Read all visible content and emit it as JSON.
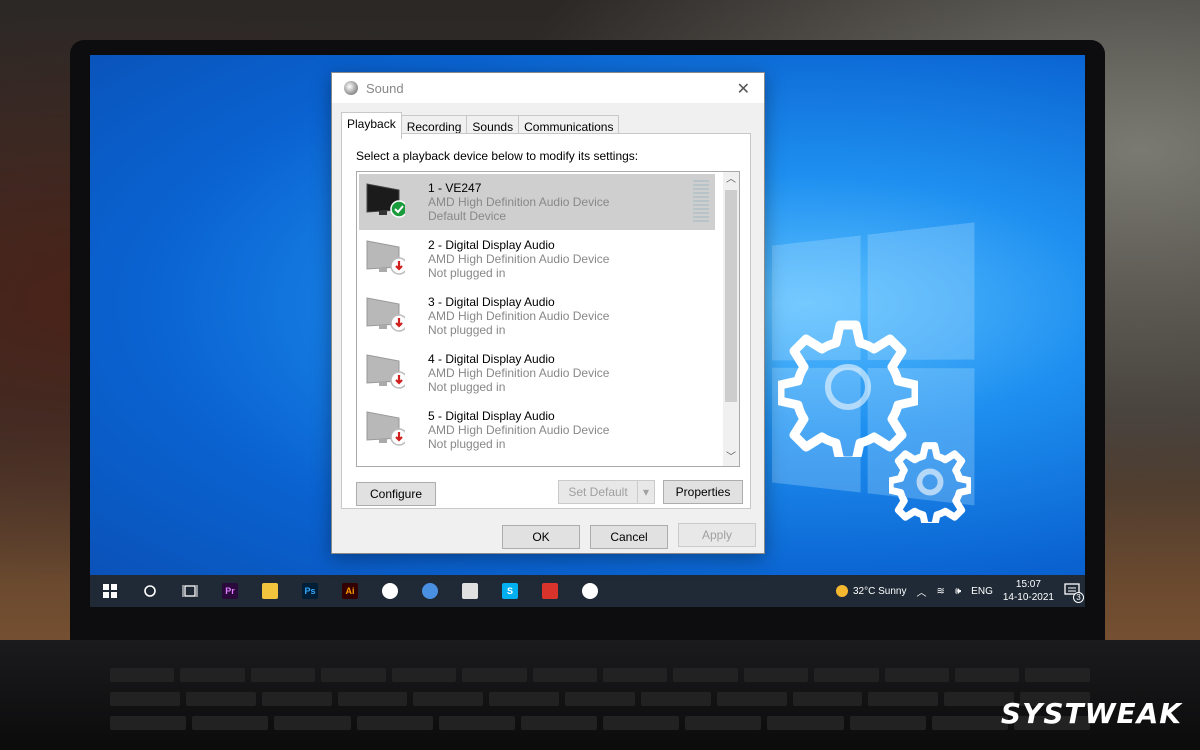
{
  "dialog": {
    "title": "Sound",
    "close_label": "✕",
    "tabs": [
      {
        "label": "Playback"
      },
      {
        "label": "Recording"
      },
      {
        "label": "Sounds"
      },
      {
        "label": "Communications"
      }
    ],
    "active_tab": "Playback",
    "instruction": "Select a playback device below to modify its settings:",
    "devices": [
      {
        "name": "1 - VE247",
        "driver": "AMD High Definition Audio Device",
        "status": "Default Device",
        "selected": true,
        "badge": "check-icon"
      },
      {
        "name": "2 - Digital Display Audio",
        "driver": "AMD High Definition Audio Device",
        "status": "Not plugged in",
        "selected": false,
        "badge": "down-arrow-icon"
      },
      {
        "name": "3 - Digital Display Audio",
        "driver": "AMD High Definition Audio Device",
        "status": "Not plugged in",
        "selected": false,
        "badge": "down-arrow-icon"
      },
      {
        "name": "4 - Digital Display Audio",
        "driver": "AMD High Definition Audio Device",
        "status": "Not plugged in",
        "selected": false,
        "badge": "down-arrow-icon"
      },
      {
        "name": "5 - Digital Display Audio",
        "driver": "AMD High Definition Audio Device",
        "status": "Not plugged in",
        "selected": false,
        "badge": "down-arrow-icon"
      }
    ],
    "buttons": {
      "configure": "Configure",
      "set_default": "Set Default",
      "properties": "Properties",
      "ok": "OK",
      "cancel": "Cancel",
      "apply": "Apply"
    }
  },
  "taskbar": {
    "apps": [
      {
        "name": "premiere-pro",
        "label": "Pr",
        "color": "#2a0a3a",
        "fg": "#e07cff"
      },
      {
        "name": "file-explorer",
        "label": "",
        "color": "#f2c43d",
        "fg": "#000"
      },
      {
        "name": "photoshop",
        "label": "Ps",
        "color": "#001e36",
        "fg": "#31a8ff"
      },
      {
        "name": "illustrator",
        "label": "Ai",
        "color": "#330000",
        "fg": "#ff9a00"
      },
      {
        "name": "chrome",
        "label": "",
        "color": "#ffffff",
        "fg": "#000"
      },
      {
        "name": "chrome-beta",
        "label": "",
        "color": "#4a90e2",
        "fg": "#000"
      },
      {
        "name": "paint",
        "label": "",
        "color": "#e0e0e0",
        "fg": "#000"
      },
      {
        "name": "skype",
        "label": "S",
        "color": "#00aff0",
        "fg": "#fff"
      },
      {
        "name": "snip-tool",
        "label": "",
        "color": "#d8342c",
        "fg": "#fff"
      },
      {
        "name": "chrome-profile",
        "label": "",
        "color": "#ffffff",
        "fg": "#000"
      }
    ],
    "weather": "32°C  Sunny",
    "language": "ENG",
    "time": "15:07",
    "date": "14-10-2021",
    "notification_count": "3"
  },
  "branding": {
    "text": "SYSTWEAK"
  },
  "colors": {
    "accent": "#0a63d1",
    "taskbar": "#1f2a36",
    "selected_row": "#cfcfcf",
    "check_green": "#1a9b3c",
    "arrow_red": "#d0201e"
  }
}
